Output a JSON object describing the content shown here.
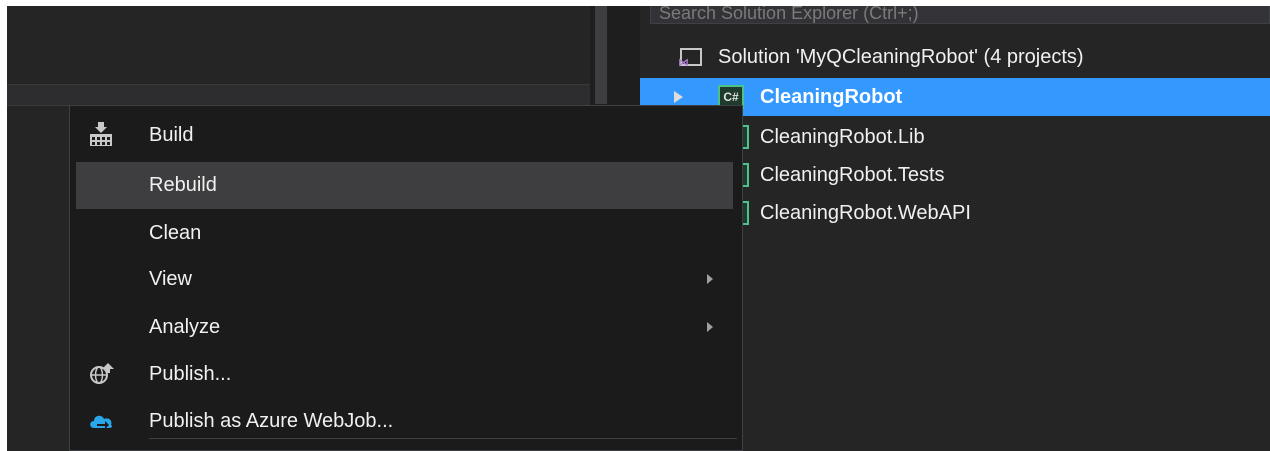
{
  "solution_explorer": {
    "search_placeholder": "Search Solution Explorer (Ctrl+;)",
    "solution_label": "Solution 'MyQCleaningRobot' (4 projects)",
    "projects": [
      {
        "label": "CleaningRobot",
        "icon": "csharp-project-icon",
        "selected": true
      },
      {
        "label": "CleaningRobot.Lib",
        "icon": "csharp-project-icon",
        "selected": false
      },
      {
        "label": "CleaningRobot.Tests",
        "icon": "csharp-project-icon",
        "selected": false
      },
      {
        "label": "CleaningRobot.WebAPI",
        "icon": "csharp-project-icon",
        "selected": false
      }
    ],
    "csharp_badge": "C#"
  },
  "context_menu": {
    "items": [
      {
        "label": "Build",
        "icon": "build-icon",
        "submenu": false
      },
      {
        "label": "Rebuild",
        "icon": "",
        "submenu": false,
        "hover": true
      },
      {
        "label": "Clean",
        "icon": "",
        "submenu": false
      },
      {
        "label": "View",
        "icon": "",
        "submenu": true
      },
      {
        "label": "Analyze",
        "icon": "",
        "submenu": true
      },
      {
        "label": "Publish...",
        "icon": "publish-globe-icon",
        "submenu": false
      },
      {
        "label": "Publish as Azure WebJob...",
        "icon": "azure-cloud-icon",
        "submenu": false
      }
    ]
  },
  "colors": {
    "selection": "#3399ff",
    "menu_background": "#1b1b1c",
    "menu_hover": "#3e3e40",
    "panel_background": "#252526",
    "text": "#f1f1f1"
  }
}
